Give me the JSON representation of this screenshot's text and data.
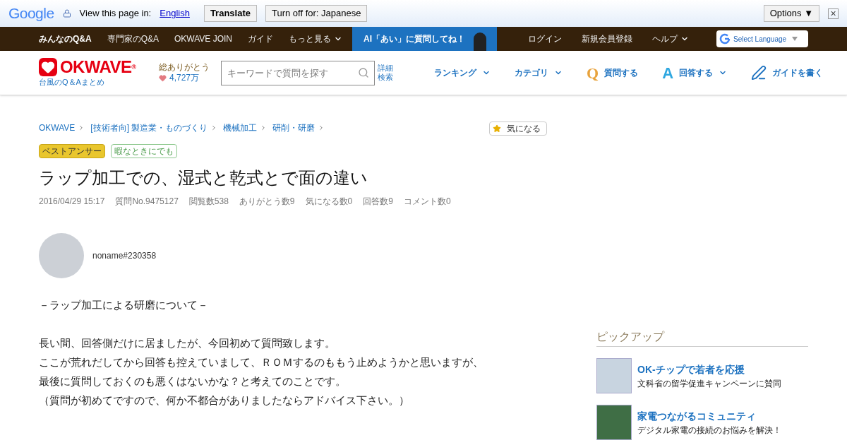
{
  "translate_bar": {
    "logo": "Google",
    "prompt": "View this page in:",
    "language": "English",
    "translate": "Translate",
    "turn_off": "Turn off for: Japanese",
    "options": "Options ▼",
    "close": "×"
  },
  "top_nav": {
    "items": [
      {
        "label": "みんなのQ&A",
        "selected": true
      },
      {
        "label": "専門家のQ&A",
        "selected": false
      },
      {
        "label": "OKWAVE JOIN",
        "selected": false
      },
      {
        "label": "ガイド",
        "selected": false
      },
      {
        "label": "もっと見る",
        "selected": false,
        "dropdown": true
      }
    ],
    "ai_banner": "AI「あい」に質問してね！",
    "right_items": [
      {
        "label": "ログイン",
        "dropdown": false
      },
      {
        "label": "新規会員登録",
        "dropdown": false
      },
      {
        "label": "ヘルプ",
        "dropdown": true
      }
    ],
    "language_select": "Select Language"
  },
  "header": {
    "logo": "OKWAVE",
    "logo_mark": "®",
    "tagline": "台風のQ＆Aまとめ",
    "thanks_label": "総ありがとう",
    "thanks_count": "4,727万",
    "search_placeholder": "キーワードで質問を探す",
    "advanced_search": [
      "詳細",
      "検索"
    ],
    "menu": [
      {
        "kind": "dropdown",
        "label": "ランキング"
      },
      {
        "kind": "dropdown",
        "label": "カテゴリ"
      },
      {
        "kind": "question",
        "letter": "Q",
        "label": "質問する"
      },
      {
        "kind": "answer",
        "letter": "A",
        "label": "回答する"
      },
      {
        "kind": "guide",
        "label": "ガイドを書く"
      }
    ]
  },
  "breadcrumbs": [
    "OKWAVE",
    "[技術者向] 製造業・ものづくり",
    "機械加工",
    "研削・研磨"
  ],
  "watch_button": "気になる",
  "tags": [
    {
      "label": "ベストアンサー",
      "kind": "best"
    },
    {
      "label": "暇なときにでも",
      "kind": "leisure"
    }
  ],
  "question": {
    "title": "ラップ加工での、湿式と乾式とで面の違い",
    "meta": [
      "2016/04/29 15:17",
      "質問No.9475127",
      "閲覧数538",
      "ありがとう数9",
      "気になる数0",
      "回答数9",
      "コメント数0"
    ],
    "author": "noname#230358",
    "body": [
      [
        "－ラップ加工による研磨について－"
      ],
      [
        "長い間、回答側だけに居ましたが、今回初めて質問致します。",
        "ここが荒れだしてから回答も控えていまして、ＲＯＭするのももう止めようかと思いますが、",
        "最後に質問しておくのも悪くはないかな？と考えてのことです。",
        "（質問が初めてですので、何か不都合がありましたならアドバイス下さい。）"
      ]
    ]
  },
  "pickup": {
    "title": "ピックアップ",
    "items": [
      {
        "title": "OK-チップで若者を応援",
        "subtitle": "文科省の留学促進キャンペーンに賛同"
      },
      {
        "title": "家電つながるコミュニティ",
        "subtitle": "デジタル家電の接続のお悩みを解決！"
      }
    ]
  }
}
